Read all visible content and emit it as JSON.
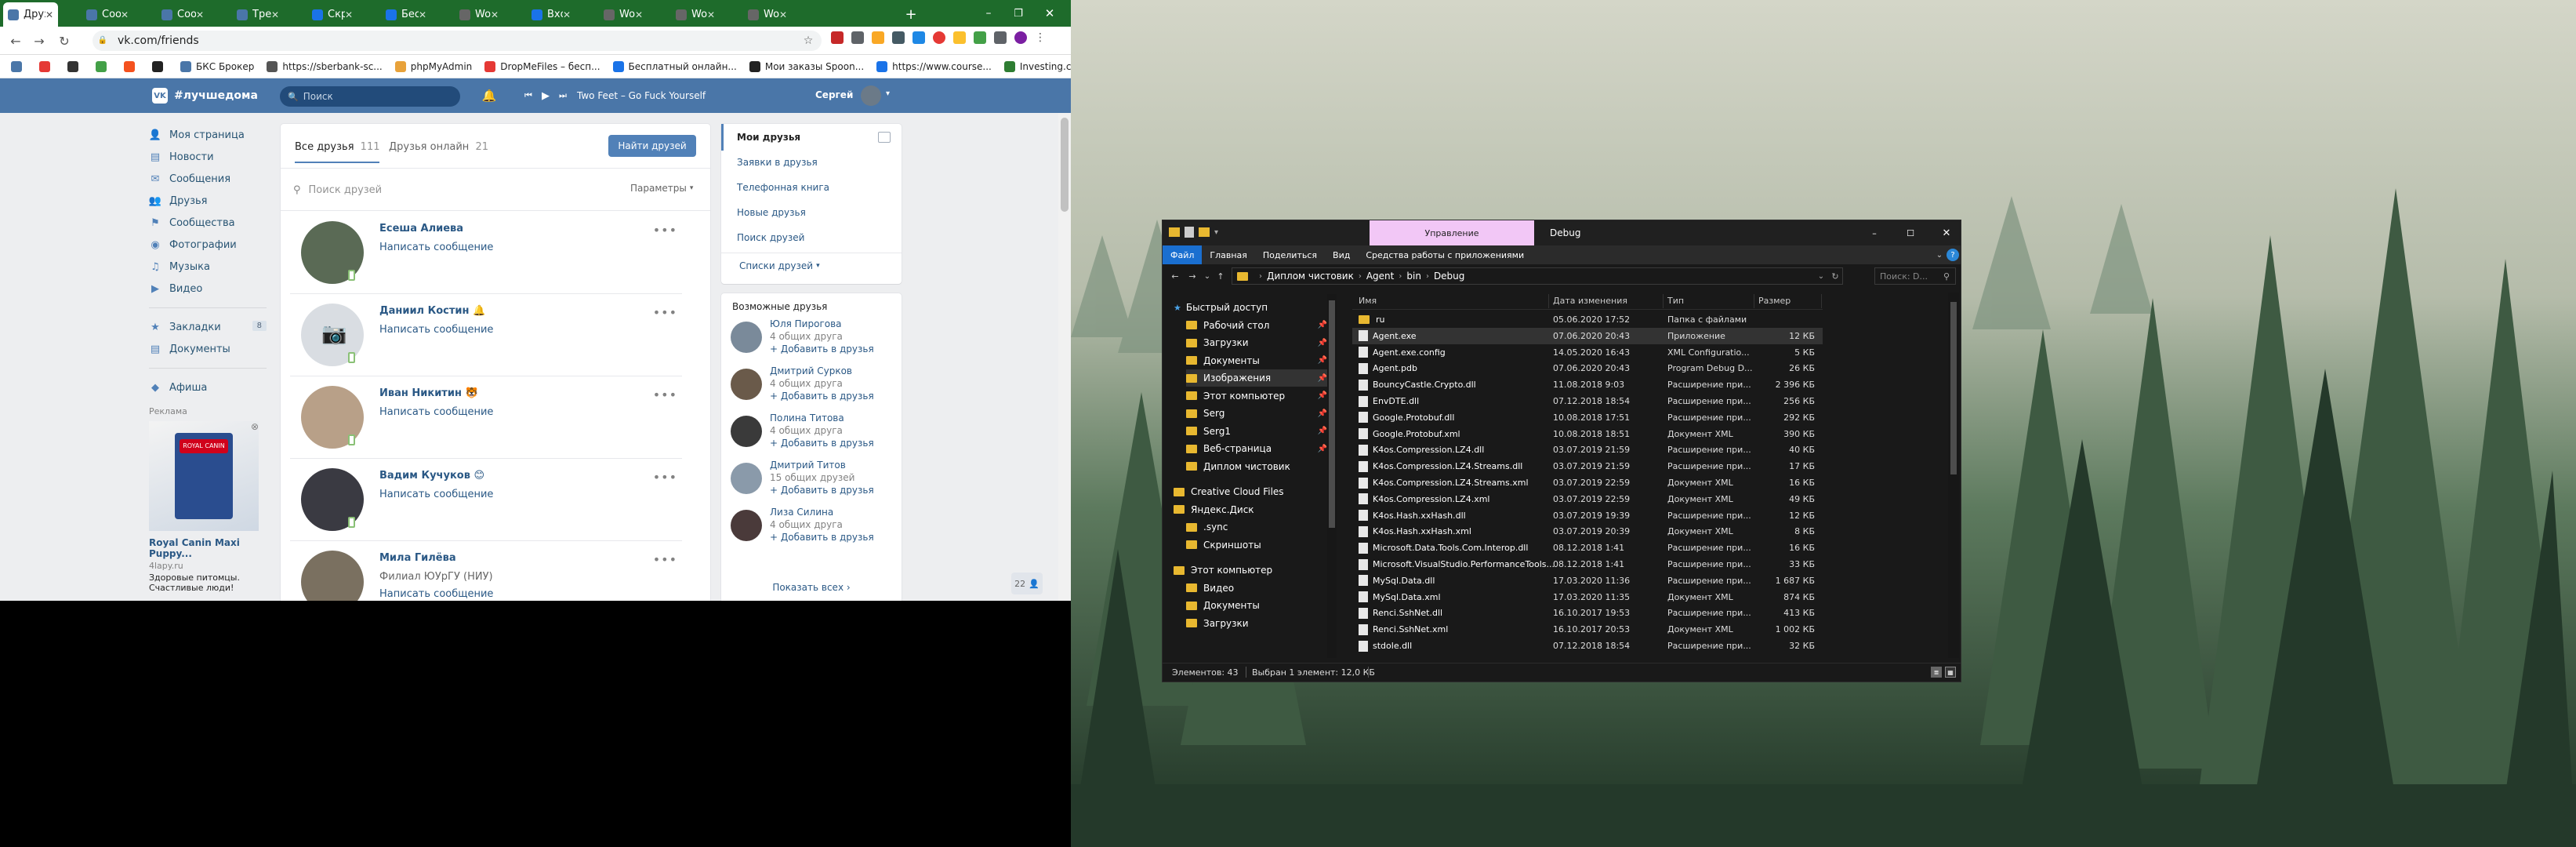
{
  "browser": {
    "tabs": [
      {
        "label": "Друзья",
        "active": true,
        "color": "#4a76a8"
      },
      {
        "label": "Сообщ",
        "color": "#4a76a8"
      },
      {
        "label": "Сообщ",
        "color": "#4a76a8"
      },
      {
        "label": "Требо",
        "color": "#4a76a8"
      },
      {
        "label": "Скрип",
        "color": "#1a73e8"
      },
      {
        "label": "Беспл",
        "color": "#1a73e8"
      },
      {
        "label": "Workt",
        "color": "#666"
      },
      {
        "label": "Входя",
        "color": "#1a73e8"
      },
      {
        "label": "Workt",
        "color": "#666"
      },
      {
        "label": "Workt",
        "color": "#666"
      },
      {
        "label": "Workt",
        "color": "#666"
      }
    ],
    "url": "vk.com/friends",
    "bookmarks": [
      "БКС Брокер",
      "https://sberbank-sc...",
      "phpMyAdmin",
      "DropMeFiles – бесп...",
      "Бесплатный онлайн...",
      "Мои заказы Spoon...",
      "https://www.course...",
      "Investing.com - ког..."
    ]
  },
  "vk": {
    "hashtag": "#лучшедома",
    "search_placeholder": "Поиск",
    "player_track": "Two Feet – Go Fuck Yourself",
    "user_name": "Сергей",
    "nav": [
      {
        "label": "Моя страница",
        "icon": "user-icon"
      },
      {
        "label": "Новости",
        "icon": "news-icon"
      },
      {
        "label": "Сообщения",
        "icon": "message-icon"
      },
      {
        "label": "Друзья",
        "icon": "friends-icon"
      },
      {
        "label": "Сообщества",
        "icon": "groups-icon"
      },
      {
        "label": "Фотографии",
        "icon": "camera-icon"
      },
      {
        "label": "Музыка",
        "icon": "music-icon"
      },
      {
        "label": "Видео",
        "icon": "video-icon"
      }
    ],
    "nav2": [
      {
        "label": "Закладки",
        "badge": "8"
      },
      {
        "label": "Документы"
      }
    ],
    "nav3": [
      {
        "label": "Афиша"
      }
    ],
    "ads_label": "Реклама",
    "ad": {
      "title": "Royal Canin Maxi Puppy...",
      "site": "4lapy.ru",
      "text": "Здоровые питомцы. Счастливые люди!"
    },
    "tabs": {
      "all": "Все друзья",
      "all_count": "111",
      "online": "Друзья онлайн",
      "online_count": "21",
      "find_button": "Найти друзей"
    },
    "friend_search_placeholder": "Поиск друзей",
    "params": "Параметры",
    "friends": [
      {
        "name": "Есеша Алиева",
        "action": "Написать сообщение",
        "avatar": "#5a6a55"
      },
      {
        "name": "Даниил Костин 🔔",
        "action": "Написать сообщение",
        "avatar": "#d9dde2"
      },
      {
        "name": "Иван Никитин 🐯",
        "action": "Написать сообщение",
        "avatar": "#b8a088"
      },
      {
        "name": "Вадим Кучуков 😊",
        "action": "Написать сообщение",
        "avatar": "#3a3a42"
      },
      {
        "name": "Мила Гилёва",
        "sub": "Филиал ЮУрГУ (НИУ)",
        "action": "Написать сообщение",
        "avatar": "#7a7060"
      }
    ],
    "right_menu": [
      "Мои друзья",
      "Заявки в друзья",
      "Телефонная книга",
      "Новые друзья",
      "Поиск друзей"
    ],
    "lists": "Списки друзей",
    "possible_title": "Возможные друзья",
    "possible": [
      {
        "name": "Юля Пирогова",
        "mutual": "4 общих друга",
        "add": "+ Добавить в друзья",
        "avatar": "#7a8a9a"
      },
      {
        "name": "Дмитрий Сурков",
        "mutual": "4 общих друга",
        "add": "+ Добавить в друзья",
        "avatar": "#6a5a4a"
      },
      {
        "name": "Полина Титова",
        "mutual": "4 общих друга",
        "add": "+ Добавить в друзья",
        "avatar": "#3a3a3a"
      },
      {
        "name": "Дмитрий Титов",
        "mutual": "15 общих друзей",
        "add": "+ Добавить в друзья",
        "avatar": "#8a9aaa"
      },
      {
        "name": "Лиза Силина",
        "mutual": "4 общих друга",
        "add": "+ Добавить в друзья",
        "avatar": "#4a3a3a"
      }
    ],
    "show_all": "Показать всех",
    "online_counter": "22"
  },
  "explorer": {
    "ribbon_context": "Управление",
    "title": "Debug",
    "ribbon_tabs": [
      "Файл",
      "Главная",
      "Поделиться",
      "Вид",
      "Средства работы с приложениями"
    ],
    "breadcrumb": [
      "Диплом чистовик",
      "Agent",
      "bin",
      "Debug"
    ],
    "search_placeholder": "Поиск: D...",
    "nav": [
      {
        "label": "Быстрый доступ",
        "icon": "star-icon",
        "indent": 0
      },
      {
        "label": "Рабочий стол",
        "indent": 1,
        "pin": true
      },
      {
        "label": "Загрузки",
        "indent": 1,
        "pin": true
      },
      {
        "label": "Документы",
        "indent": 1,
        "pin": true
      },
      {
        "label": "Изображения",
        "indent": 1,
        "pin": true
      },
      {
        "label": "Этот компьютер",
        "indent": 1,
        "pin": true
      },
      {
        "label": "Serg",
        "indent": 1,
        "pin": true
      },
      {
        "label": "Serg1",
        "indent": 1,
        "pin": true
      },
      {
        "label": "Веб-страница",
        "indent": 1,
        "pin": true
      },
      {
        "label": "Диплом чистовик",
        "indent": 1
      },
      {
        "label": "Creative Cloud Files",
        "indent": 0
      },
      {
        "label": "Яндекс.Диск",
        "indent": 0
      },
      {
        "label": ".sync",
        "indent": 1
      },
      {
        "label": "Скриншоты",
        "indent": 1
      },
      {
        "label": "Этот компьютер",
        "indent": 0
      },
      {
        "label": "Видео",
        "indent": 1
      },
      {
        "label": "Документы",
        "indent": 1
      },
      {
        "label": "Загрузки",
        "indent": 1
      }
    ],
    "columns": [
      "Имя",
      "Дата изменения",
      "Тип",
      "Размер"
    ],
    "files": [
      [
        "ru",
        "05.06.2020 17:52",
        "Папка с файлами",
        ""
      ],
      [
        "Agent.exe",
        "07.06.2020 20:43",
        "Приложение",
        "12 КБ"
      ],
      [
        "Agent.exe.config",
        "14.05.2020 16:43",
        "XML Configuratio...",
        "5 КБ"
      ],
      [
        "Agent.pdb",
        "07.06.2020 20:43",
        "Program Debug D...",
        "26 КБ"
      ],
      [
        "BouncyCastle.Crypto.dll",
        "11.08.2018 9:03",
        "Расширение при...",
        "2 396 КБ"
      ],
      [
        "EnvDTE.dll",
        "07.12.2018 18:54",
        "Расширение при...",
        "256 КБ"
      ],
      [
        "Google.Protobuf.dll",
        "10.08.2018 17:51",
        "Расширение при...",
        "292 КБ"
      ],
      [
        "Google.Protobuf.xml",
        "10.08.2018 18:51",
        "Документ XML",
        "390 КБ"
      ],
      [
        "K4os.Compression.LZ4.dll",
        "03.07.2019 21:59",
        "Расширение при...",
        "40 КБ"
      ],
      [
        "K4os.Compression.LZ4.Streams.dll",
        "03.07.2019 21:59",
        "Расширение при...",
        "17 КБ"
      ],
      [
        "K4os.Compression.LZ4.Streams.xml",
        "03.07.2019 22:59",
        "Документ XML",
        "16 КБ"
      ],
      [
        "K4os.Compression.LZ4.xml",
        "03.07.2019 22:59",
        "Документ XML",
        "49 КБ"
      ],
      [
        "K4os.Hash.xxHash.dll",
        "03.07.2019 19:39",
        "Расширение при...",
        "12 КБ"
      ],
      [
        "K4os.Hash.xxHash.xml",
        "03.07.2019 20:39",
        "Документ XML",
        "8 КБ"
      ],
      [
        "Microsoft.Data.Tools.Com.Interop.dll",
        "08.12.2018 1:41",
        "Расширение при...",
        "16 КБ"
      ],
      [
        "Microsoft.VisualStudio.PerformanceTools...",
        "08.12.2018 1:41",
        "Расширение при...",
        "33 КБ"
      ],
      [
        "MySql.Data.dll",
        "17.03.2020 11:36",
        "Расширение при...",
        "1 687 КБ"
      ],
      [
        "MySql.Data.xml",
        "17.03.2020 11:35",
        "Документ XML",
        "874 КБ"
      ],
      [
        "Renci.SshNet.dll",
        "16.10.2017 19:53",
        "Расширение при...",
        "413 КБ"
      ],
      [
        "Renci.SshNet.xml",
        "16.10.2017 20:53",
        "Документ XML",
        "1 002 КБ"
      ],
      [
        "stdole.dll",
        "07.12.2018 18:54",
        "Расширение при...",
        "32 КБ"
      ]
    ],
    "status_items": "Элементов: 43",
    "status_selected": "Выбран 1 элемент: 12,0 КБ"
  }
}
